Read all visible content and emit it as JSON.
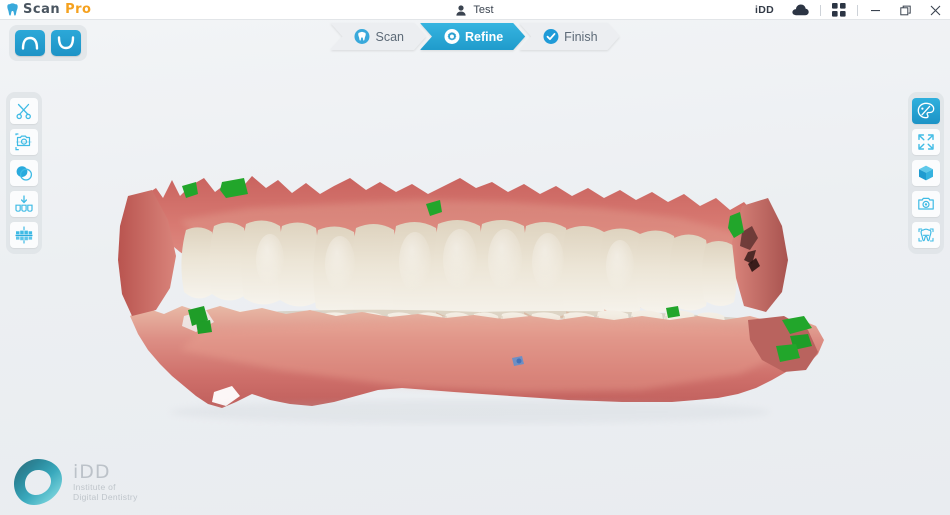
{
  "app": {
    "brand_scan": "Scan",
    "brand_pro": "Pro",
    "brand_icon": "tooth-icon"
  },
  "titlebar": {
    "user_icon": "user-icon",
    "user_name": "Test",
    "idd_label": "iDD",
    "cloud_icon": "cloud-icon",
    "grid_icon": "grid-apps-icon",
    "minimize_icon": "minimize-icon",
    "restore_icon": "restore-window-icon",
    "close_icon": "close-icon"
  },
  "arch_toggle": {
    "upper_icon": "upper-arch-icon",
    "upper_label": "Upper Arch",
    "lower_icon": "lower-arch-icon",
    "lower_label": "Lower Arch",
    "active_color": "#1f9bcb"
  },
  "steps": {
    "active": "Refine",
    "items": [
      {
        "label": "Scan",
        "icon": "tooth-circle-icon",
        "active": false
      },
      {
        "label": "Refine",
        "icon": "gear-circle-icon",
        "active": true
      },
      {
        "label": "Finish",
        "icon": "check-circle-icon",
        "active": false
      }
    ]
  },
  "left_toolbar": {
    "items": [
      {
        "icon": "scissors-trim-icon",
        "label": "Trim"
      },
      {
        "icon": "camera-crop-icon",
        "label": "Capture Region"
      },
      {
        "icon": "overlap-circles-icon",
        "label": "Overlay"
      },
      {
        "icon": "teeth-align-down-icon",
        "label": "Align Bite"
      },
      {
        "icon": "teeth-occlusion-icon",
        "label": "Occlusion"
      }
    ]
  },
  "right_toolbar": {
    "active_index": 0,
    "items": [
      {
        "icon": "palette-icon",
        "label": "Texture / Color"
      },
      {
        "icon": "fullscreen-icon",
        "label": "Fit To Screen"
      },
      {
        "icon": "cube-3d-icon",
        "label": "3D View"
      },
      {
        "icon": "camera-icon",
        "label": "Screenshot"
      },
      {
        "icon": "tooth-scan-icon",
        "label": "Tooth Scan"
      }
    ]
  },
  "watermark": {
    "logo_icon": "idd-triangle-logo",
    "title": "iDD",
    "line1": "Institute of",
    "line2": "Digital Dentistry"
  },
  "model": {
    "name": "dental-arch-3d-scan",
    "gingiva_color": "#d8736c",
    "tooth_color": "#e9e2d4",
    "marker_color": "#22a62b",
    "background_color": "#eceff2"
  }
}
